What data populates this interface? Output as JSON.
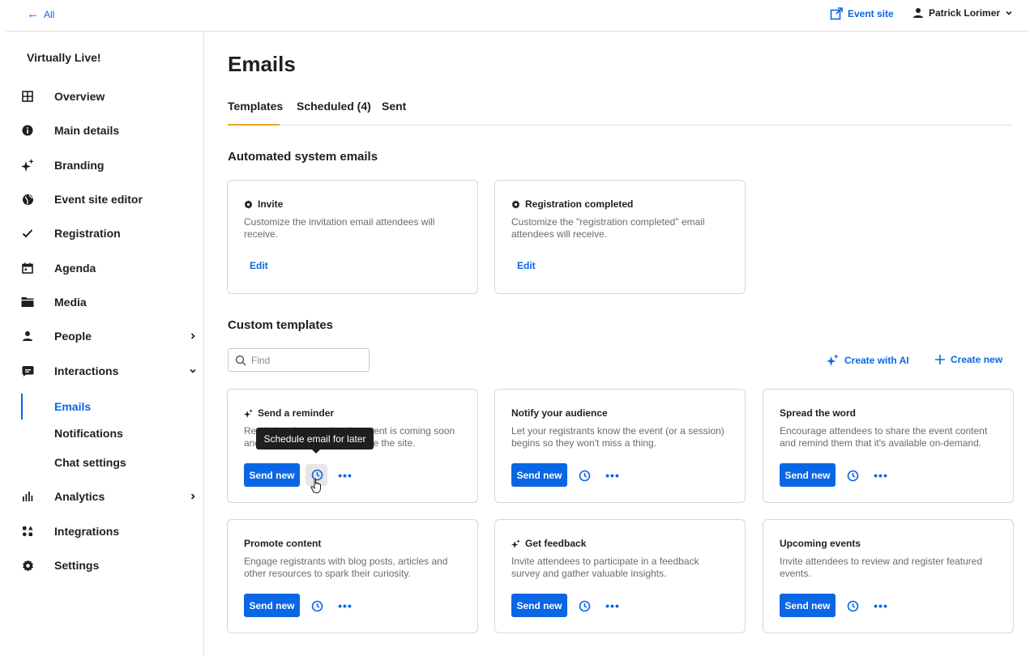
{
  "topbar": {
    "back_label": "All",
    "event_site_label": "Event site",
    "user_name": "Patrick Lorimer"
  },
  "sidebar": {
    "event_name": "Virtually Live!",
    "items": [
      {
        "label": "Overview",
        "icon": "grid-icon"
      },
      {
        "label": "Main details",
        "icon": "info-icon"
      },
      {
        "label": "Branding",
        "icon": "sparkle-icon"
      },
      {
        "label": "Event site editor",
        "icon": "globe-icon"
      },
      {
        "label": "Registration",
        "icon": "check-icon"
      },
      {
        "label": "Agenda",
        "icon": "calendar-icon"
      },
      {
        "label": "Media",
        "icon": "folder-icon"
      },
      {
        "label": "People",
        "icon": "person-icon"
      },
      {
        "label": "Interactions",
        "icon": "chat-icon"
      },
      {
        "label": "Analytics",
        "icon": "bar-chart-icon"
      },
      {
        "label": "Integrations",
        "icon": "apps-icon"
      },
      {
        "label": "Settings",
        "icon": "gear-icon"
      }
    ],
    "subitems": [
      {
        "label": "Emails",
        "active": true
      },
      {
        "label": "Notifications",
        "active": false
      },
      {
        "label": "Chat settings",
        "active": false
      }
    ]
  },
  "main": {
    "title": "Emails",
    "tabs": [
      {
        "label": "Templates",
        "active": true
      },
      {
        "label": "Scheduled (4)",
        "active": false
      },
      {
        "label": "Sent",
        "active": false
      }
    ],
    "automated_title": "Automated system emails",
    "automated": [
      {
        "title": "Invite",
        "desc": "Customize the invitation email attendees will receive.",
        "action": "Edit"
      },
      {
        "title": "Registration completed",
        "desc": "Customize the \"registration completed\" email attendees will receive.",
        "action": "Edit"
      }
    ],
    "custom_title": "Custom templates",
    "search_placeholder": "Find",
    "create_ai_label": "Create with AI",
    "create_new_label": "Create new",
    "send_label": "Send new",
    "tooltip": "Schedule email for later",
    "templates": [
      {
        "title": "Send a reminder",
        "ai": true,
        "desc": "Remind registrants that the event is coming soon and encourage them to explore the site."
      },
      {
        "title": "Notify your audience",
        "ai": false,
        "desc": "Let your registrants know the event (or a session) begins so they won't miss a thing."
      },
      {
        "title": "Spread the word",
        "ai": false,
        "desc": "Encourage attendees to share the event content and remind them that it's available on-demand."
      },
      {
        "title": "Promote content",
        "ai": false,
        "desc": "Engage registrants with blog posts, articles and other resources to spark their curiosity."
      },
      {
        "title": "Get feedback",
        "ai": true,
        "desc": "Invite attendees to participate in a feedback survey and gather valuable insights."
      },
      {
        "title": "Upcoming events",
        "ai": false,
        "desc": "Invite attendees to review and register featured events."
      }
    ]
  },
  "colors": {
    "accent": "#0a66e4",
    "tab_underline": "#f1a225",
    "tooltip_bg": "#1f1f1f"
  }
}
